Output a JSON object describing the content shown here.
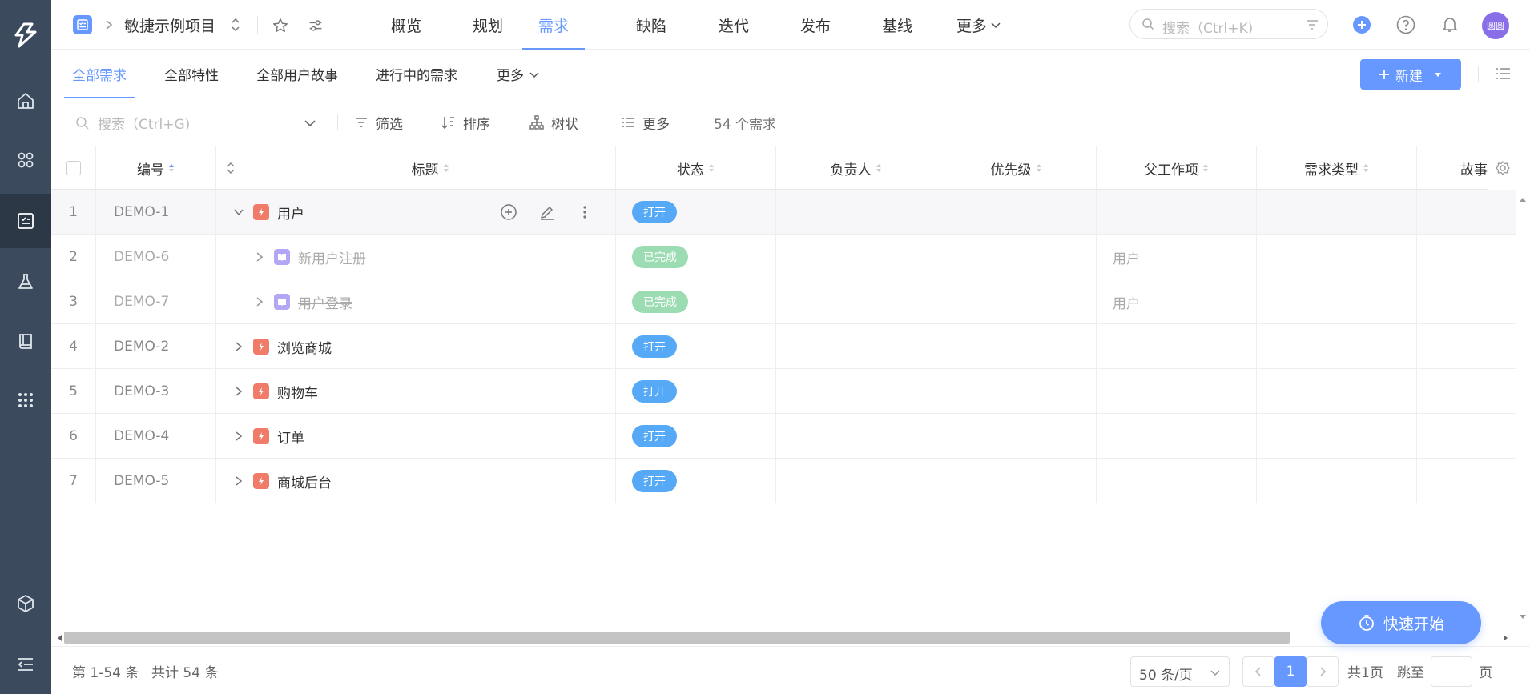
{
  "header": {
    "project_name": "敏捷示例项目",
    "nav": [
      "概览",
      "规划",
      "需求",
      "缺陷",
      "迭代",
      "发布",
      "基线",
      "更多"
    ],
    "active_nav": "需求",
    "search_placeholder": "搜索（Ctrl+K)",
    "avatar_text": "圆圆",
    "accent_color": "#6698ff"
  },
  "subtabs": {
    "items": [
      "全部需求",
      "全部特性",
      "全部用户故事",
      "进行中的需求",
      "更多"
    ],
    "active": "全部需求",
    "new_button": "新建"
  },
  "toolbar": {
    "search_placeholder": "搜索（Ctrl+G)",
    "filter": "筛选",
    "sort": "排序",
    "tree": "树状",
    "more": "更多",
    "count": "54 个需求"
  },
  "table": {
    "columns": {
      "id": "编号",
      "title": "标题",
      "status": "状态",
      "owner": "负责人",
      "priority": "优先级",
      "parent": "父工作项",
      "type": "需求类型",
      "story": "故事"
    },
    "rows": [
      {
        "index": "1",
        "id": "DEMO-1",
        "title": "用户",
        "kind": "feature",
        "status": "打开",
        "parent": "",
        "expanded": true
      },
      {
        "index": "2",
        "id": "DEMO-6",
        "title": "新用户注册",
        "kind": "story",
        "status": "已完成",
        "parent": "用户",
        "expanded": false
      },
      {
        "index": "3",
        "id": "DEMO-7",
        "title": "用户登录",
        "kind": "story",
        "status": "已完成",
        "parent": "用户",
        "expanded": false
      },
      {
        "index": "4",
        "id": "DEMO-2",
        "title": "浏览商城",
        "kind": "feature",
        "status": "打开",
        "parent": "",
        "expanded": false
      },
      {
        "index": "5",
        "id": "DEMO-3",
        "title": "购物车",
        "kind": "feature",
        "status": "打开",
        "parent": "",
        "expanded": false
      },
      {
        "index": "6",
        "id": "DEMO-4",
        "title": "订单",
        "kind": "feature",
        "status": "打开",
        "parent": "",
        "expanded": false
      },
      {
        "index": "7",
        "id": "DEMO-5",
        "title": "商城后台",
        "kind": "feature",
        "status": "打开",
        "parent": "",
        "expanded": false
      }
    ],
    "status_colors": {
      "打开": "#56a9f6",
      "已完成": "#9bdcb2"
    }
  },
  "footer": {
    "range": "第 1-54 条",
    "total": "共计 54 条",
    "page_size": "50 条/页",
    "current_page": "1",
    "total_pages": "共1页",
    "jump_label": "跳至",
    "page_unit": "页"
  },
  "quick_start": "快速开始"
}
